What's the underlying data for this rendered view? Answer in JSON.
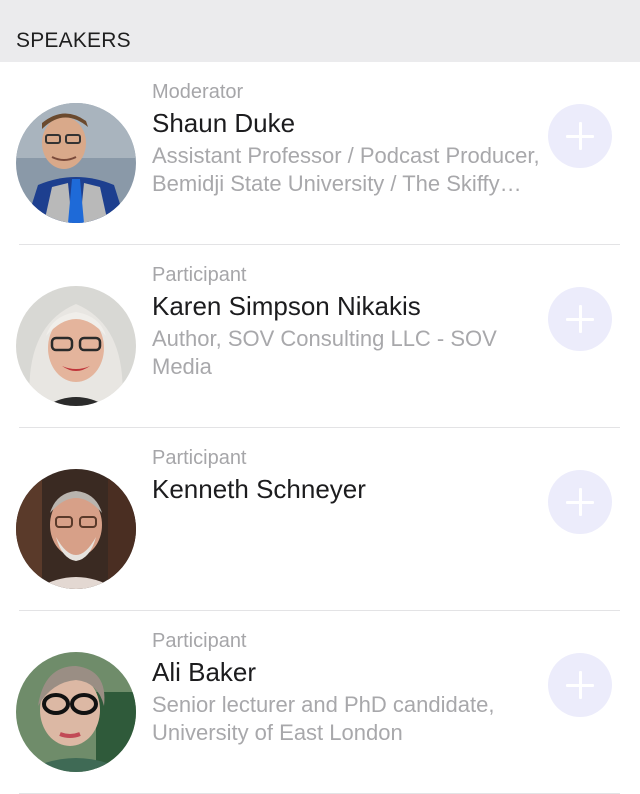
{
  "section": {
    "title": "SPEAKERS"
  },
  "speakers": [
    {
      "role": "Moderator",
      "name": "Shaun Duke",
      "bio": "Assistant Professor / Podcast Producer, Bemidji State University / The Skiffy and Fanty Show",
      "avatar_icon": "avatar-photo-man-blue-tie"
    },
    {
      "role": "Participant",
      "name": "Karen Simpson Nikakis",
      "bio": "Author, SOV Consulting LLC - SOV Media",
      "avatar_icon": "avatar-photo-woman-white-hair"
    },
    {
      "role": "Participant",
      "name": "Kenneth Schneyer",
      "bio": "",
      "avatar_icon": "avatar-photo-man-beard-glasses"
    },
    {
      "role": "Participant",
      "name": "Ali Baker",
      "bio": "Senior lecturer and PhD candidate, University of East London",
      "avatar_icon": "avatar-photo-woman-glasses"
    }
  ],
  "add_icon": "plus-icon",
  "colors": {
    "header_bg": "#ebebed",
    "add_button_bg": "#ececfb",
    "role_text": "#a6a6a9",
    "name_text": "#1c1c1e"
  }
}
